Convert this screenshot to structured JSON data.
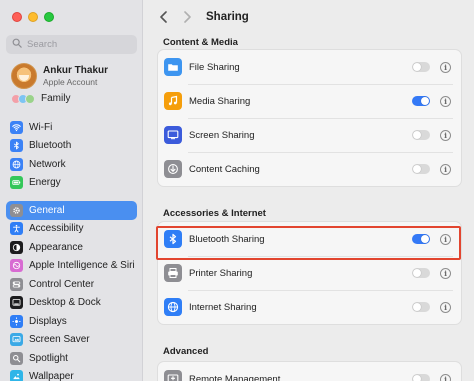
{
  "window": {
    "traffic_lights": [
      "close",
      "minimize",
      "zoom"
    ],
    "colors": {
      "close": "#fe5f57",
      "minimize": "#febc2e",
      "zoom": "#28c840"
    }
  },
  "sidebar": {
    "search_placeholder": "Search",
    "account": {
      "name": "Ankur Thakur",
      "subtitle": "Apple Account"
    },
    "family_label": "Family",
    "group1": [
      {
        "label": "Wi-Fi",
        "icon": "wifi-icon",
        "color": "#3b82f6"
      },
      {
        "label": "Bluetooth",
        "icon": "bluetooth-icon",
        "color": "#3b82f6"
      },
      {
        "label": "Network",
        "icon": "globe-icon",
        "color": "#3b82f6"
      },
      {
        "label": "Energy",
        "icon": "battery-icon",
        "color": "#34c759"
      }
    ],
    "group2": [
      {
        "label": "General",
        "icon": "gear-icon",
        "color": "#8e8e93",
        "selected": true
      },
      {
        "label": "Accessibility",
        "icon": "accessibility-icon",
        "color": "#2f7ef6"
      },
      {
        "label": "Appearance",
        "icon": "appearance-icon",
        "color": "#1c1c1e"
      },
      {
        "label": "Apple Intelligence & Siri",
        "icon": "siri-icon",
        "color": "#d86bd2"
      },
      {
        "label": "Control Center",
        "icon": "control-center-icon",
        "color": "#8e8e93"
      },
      {
        "label": "Desktop & Dock",
        "icon": "dock-icon",
        "color": "#1c1c1e"
      },
      {
        "label": "Displays",
        "icon": "display-icon",
        "color": "#2f7ef6"
      },
      {
        "label": "Screen Saver",
        "icon": "screensaver-icon",
        "color": "#3aa9e6"
      },
      {
        "label": "Spotlight",
        "icon": "spotlight-icon",
        "color": "#8e8e93"
      },
      {
        "label": "Wallpaper",
        "icon": "wallpaper-icon",
        "color": "#2fb5e8"
      }
    ]
  },
  "main": {
    "title": "Sharing",
    "sections": [
      {
        "title": "Content & Media",
        "rows": [
          {
            "label": "File Sharing",
            "icon": "folder-icon",
            "color": "#3d95f0",
            "on": false
          },
          {
            "label": "Media Sharing",
            "icon": "music-icon",
            "color": "#f59e0b",
            "on": true
          },
          {
            "label": "Screen Sharing",
            "icon": "screen-sharing-icon",
            "color": "#3b5bdb",
            "on": false
          },
          {
            "label": "Content Caching",
            "icon": "content-caching-icon",
            "color": "#8e8e93",
            "on": false
          }
        ]
      },
      {
        "title": "Accessories & Internet",
        "rows": [
          {
            "label": "Bluetooth Sharing",
            "icon": "bluetooth-icon",
            "color": "#2f7ef6",
            "on": true,
            "highlighted": true
          },
          {
            "label": "Printer Sharing",
            "icon": "printer-icon",
            "color": "#8e8e93",
            "on": false
          },
          {
            "label": "Internet Sharing",
            "icon": "globe-icon",
            "color": "#2f7ef6",
            "on": false
          }
        ]
      },
      {
        "title": "Advanced",
        "rows": [
          {
            "label": "Remote Management",
            "icon": "remote-management-icon",
            "color": "#8e8e93",
            "on": false
          }
        ]
      }
    ],
    "highlight_color": "#e2452f"
  }
}
